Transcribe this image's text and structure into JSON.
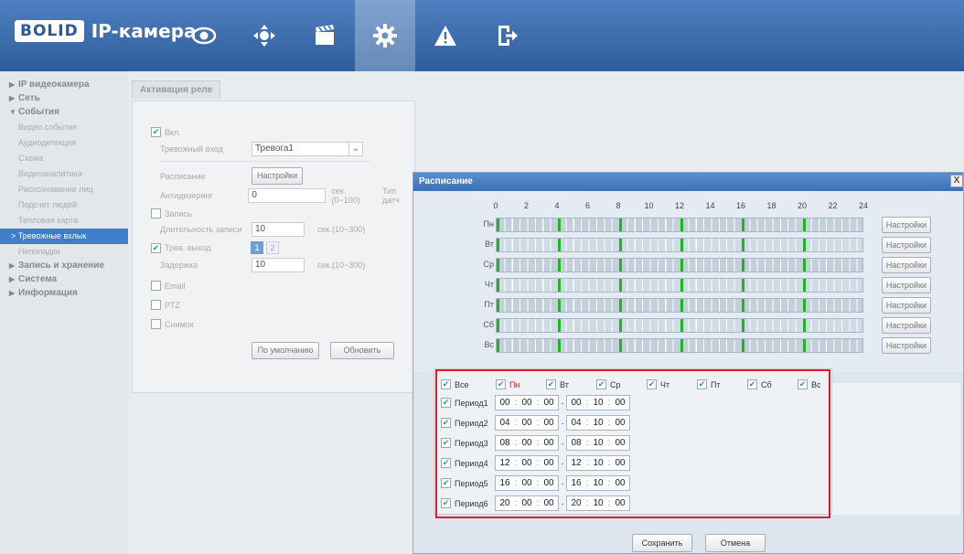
{
  "app": {
    "logo": "BOLID",
    "title": "IP-камера"
  },
  "nav": [
    {
      "icon": "eye-icon"
    },
    {
      "icon": "ptz-joystick-icon"
    },
    {
      "icon": "clapperboard-icon"
    },
    {
      "icon": "gear-icon",
      "active": true
    },
    {
      "icon": "warning-icon"
    },
    {
      "icon": "exit-icon"
    }
  ],
  "sidebar": {
    "groups": [
      {
        "label": "IP видеокамера",
        "arrow": "▶"
      },
      {
        "label": "Сеть",
        "arrow": "▶"
      },
      {
        "label": "События",
        "arrow": "▼"
      }
    ],
    "events_items": [
      "Видео события",
      "Аудиодетекция",
      "Схема",
      "Видеоаналитика",
      "Распознавание лиц",
      "Подсчет людей",
      "Тепловая карта",
      "Тревожные вхлык",
      "Неполадки"
    ],
    "active_item": "Тревожные вхлык",
    "groups_after": [
      {
        "label": "Запись и хранение",
        "arrow": "▶"
      },
      {
        "label": "Система",
        "arrow": "▶"
      },
      {
        "label": "Информация",
        "arrow": "▶"
      }
    ]
  },
  "tab": {
    "label": "Активация реле"
  },
  "form": {
    "enable_label": "Вкл.",
    "alarm_input_label": "Тревожный вход",
    "alarm_input_value": "Тревога1",
    "schedule_label": "Расписание",
    "schedule_button": "Настройки",
    "antidither_label": "Антидизеринг",
    "antidither_value": "0",
    "antidither_unit": "сек.(0~100)",
    "sensor_type_label": "Тип датч",
    "record_label": "Запись",
    "duration_label": "Длительность записи",
    "duration_value": "10",
    "duration_unit": "сек.(10~300)",
    "alarm_out_label": "Трев. выход",
    "alarm_out_1": "1",
    "alarm_out_2": "2",
    "delay_label": "Задержка",
    "delay_value": "10",
    "delay_unit": "сек.(10~300)",
    "email_label": "Email",
    "ptz_label": "PTZ",
    "snapshot_label": "Снимок",
    "default_button": "По умолчанию",
    "refresh_button": "Обновить"
  },
  "modal": {
    "title": "Расписание",
    "close": "X",
    "hours": [
      "0",
      "2",
      "4",
      "6",
      "8",
      "10",
      "12",
      "14",
      "16",
      "18",
      "20",
      "22",
      "24"
    ],
    "days": [
      "Пн",
      "Вт",
      "Ср",
      "Чт",
      "Пт",
      "Сб",
      "Вс"
    ],
    "setup_button": "Настройки",
    "marks_hours": [
      0,
      4,
      8,
      12,
      16,
      20
    ],
    "all_label": "Все",
    "day_checks": [
      "Пн",
      "Вт",
      "Ср",
      "Чт",
      "Пт",
      "Сб",
      "Вс"
    ],
    "periods": [
      {
        "label": "Период1",
        "start": [
          "00",
          "00",
          "00"
        ],
        "end": [
          "00",
          "10",
          "00"
        ]
      },
      {
        "label": "Период2",
        "start": [
          "04",
          "00",
          "00"
        ],
        "end": [
          "04",
          "10",
          "00"
        ]
      },
      {
        "label": "Период3",
        "start": [
          "08",
          "00",
          "00"
        ],
        "end": [
          "08",
          "10",
          "00"
        ]
      },
      {
        "label": "Период4",
        "start": [
          "12",
          "00",
          "00"
        ],
        "end": [
          "12",
          "10",
          "00"
        ]
      },
      {
        "label": "Период5",
        "start": [
          "16",
          "00",
          "00"
        ],
        "end": [
          "16",
          "10",
          "00"
        ]
      },
      {
        "label": "Период6",
        "start": [
          "20",
          "00",
          "00"
        ],
        "end": [
          "20",
          "10",
          "00"
        ]
      }
    ],
    "save_button": "Сохранить",
    "cancel_button": "Отмена"
  },
  "colors": {
    "header": "#3c6cae",
    "active_nav": "#6d8fc0",
    "highlight_red": "#e21c24",
    "mark_green": "#1fb51f"
  }
}
